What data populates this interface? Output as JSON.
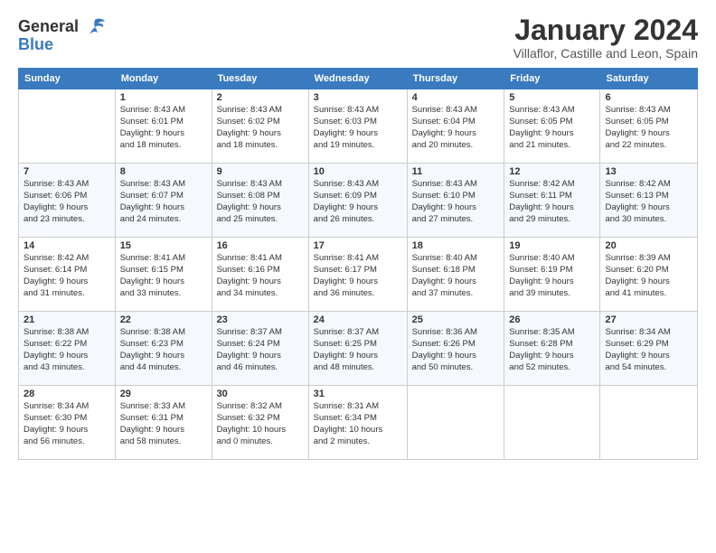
{
  "logo": {
    "line1": "General",
    "line2": "Blue"
  },
  "title": "January 2024",
  "subtitle": "Villaflor, Castille and Leon, Spain",
  "weekdays": [
    "Sunday",
    "Monday",
    "Tuesday",
    "Wednesday",
    "Thursday",
    "Friday",
    "Saturday"
  ],
  "weeks": [
    [
      {
        "day": "",
        "info": ""
      },
      {
        "day": "1",
        "info": "Sunrise: 8:43 AM\nSunset: 6:01 PM\nDaylight: 9 hours\nand 18 minutes."
      },
      {
        "day": "2",
        "info": "Sunrise: 8:43 AM\nSunset: 6:02 PM\nDaylight: 9 hours\nand 18 minutes."
      },
      {
        "day": "3",
        "info": "Sunrise: 8:43 AM\nSunset: 6:03 PM\nDaylight: 9 hours\nand 19 minutes."
      },
      {
        "day": "4",
        "info": "Sunrise: 8:43 AM\nSunset: 6:04 PM\nDaylight: 9 hours\nand 20 minutes."
      },
      {
        "day": "5",
        "info": "Sunrise: 8:43 AM\nSunset: 6:05 PM\nDaylight: 9 hours\nand 21 minutes."
      },
      {
        "day": "6",
        "info": "Sunrise: 8:43 AM\nSunset: 6:05 PM\nDaylight: 9 hours\nand 22 minutes."
      }
    ],
    [
      {
        "day": "7",
        "info": "Sunrise: 8:43 AM\nSunset: 6:06 PM\nDaylight: 9 hours\nand 23 minutes."
      },
      {
        "day": "8",
        "info": "Sunrise: 8:43 AM\nSunset: 6:07 PM\nDaylight: 9 hours\nand 24 minutes."
      },
      {
        "day": "9",
        "info": "Sunrise: 8:43 AM\nSunset: 6:08 PM\nDaylight: 9 hours\nand 25 minutes."
      },
      {
        "day": "10",
        "info": "Sunrise: 8:43 AM\nSunset: 6:09 PM\nDaylight: 9 hours\nand 26 minutes."
      },
      {
        "day": "11",
        "info": "Sunrise: 8:43 AM\nSunset: 6:10 PM\nDaylight: 9 hours\nand 27 minutes."
      },
      {
        "day": "12",
        "info": "Sunrise: 8:42 AM\nSunset: 6:11 PM\nDaylight: 9 hours\nand 29 minutes."
      },
      {
        "day": "13",
        "info": "Sunrise: 8:42 AM\nSunset: 6:13 PM\nDaylight: 9 hours\nand 30 minutes."
      }
    ],
    [
      {
        "day": "14",
        "info": "Sunrise: 8:42 AM\nSunset: 6:14 PM\nDaylight: 9 hours\nand 31 minutes."
      },
      {
        "day": "15",
        "info": "Sunrise: 8:41 AM\nSunset: 6:15 PM\nDaylight: 9 hours\nand 33 minutes."
      },
      {
        "day": "16",
        "info": "Sunrise: 8:41 AM\nSunset: 6:16 PM\nDaylight: 9 hours\nand 34 minutes."
      },
      {
        "day": "17",
        "info": "Sunrise: 8:41 AM\nSunset: 6:17 PM\nDaylight: 9 hours\nand 36 minutes."
      },
      {
        "day": "18",
        "info": "Sunrise: 8:40 AM\nSunset: 6:18 PM\nDaylight: 9 hours\nand 37 minutes."
      },
      {
        "day": "19",
        "info": "Sunrise: 8:40 AM\nSunset: 6:19 PM\nDaylight: 9 hours\nand 39 minutes."
      },
      {
        "day": "20",
        "info": "Sunrise: 8:39 AM\nSunset: 6:20 PM\nDaylight: 9 hours\nand 41 minutes."
      }
    ],
    [
      {
        "day": "21",
        "info": "Sunrise: 8:38 AM\nSunset: 6:22 PM\nDaylight: 9 hours\nand 43 minutes."
      },
      {
        "day": "22",
        "info": "Sunrise: 8:38 AM\nSunset: 6:23 PM\nDaylight: 9 hours\nand 44 minutes."
      },
      {
        "day": "23",
        "info": "Sunrise: 8:37 AM\nSunset: 6:24 PM\nDaylight: 9 hours\nand 46 minutes."
      },
      {
        "day": "24",
        "info": "Sunrise: 8:37 AM\nSunset: 6:25 PM\nDaylight: 9 hours\nand 48 minutes."
      },
      {
        "day": "25",
        "info": "Sunrise: 8:36 AM\nSunset: 6:26 PM\nDaylight: 9 hours\nand 50 minutes."
      },
      {
        "day": "26",
        "info": "Sunrise: 8:35 AM\nSunset: 6:28 PM\nDaylight: 9 hours\nand 52 minutes."
      },
      {
        "day": "27",
        "info": "Sunrise: 8:34 AM\nSunset: 6:29 PM\nDaylight: 9 hours\nand 54 minutes."
      }
    ],
    [
      {
        "day": "28",
        "info": "Sunrise: 8:34 AM\nSunset: 6:30 PM\nDaylight: 9 hours\nand 56 minutes."
      },
      {
        "day": "29",
        "info": "Sunrise: 8:33 AM\nSunset: 6:31 PM\nDaylight: 9 hours\nand 58 minutes."
      },
      {
        "day": "30",
        "info": "Sunrise: 8:32 AM\nSunset: 6:32 PM\nDaylight: 10 hours\nand 0 minutes."
      },
      {
        "day": "31",
        "info": "Sunrise: 8:31 AM\nSunset: 6:34 PM\nDaylight: 10 hours\nand 2 minutes."
      },
      {
        "day": "",
        "info": ""
      },
      {
        "day": "",
        "info": ""
      },
      {
        "day": "",
        "info": ""
      }
    ]
  ]
}
